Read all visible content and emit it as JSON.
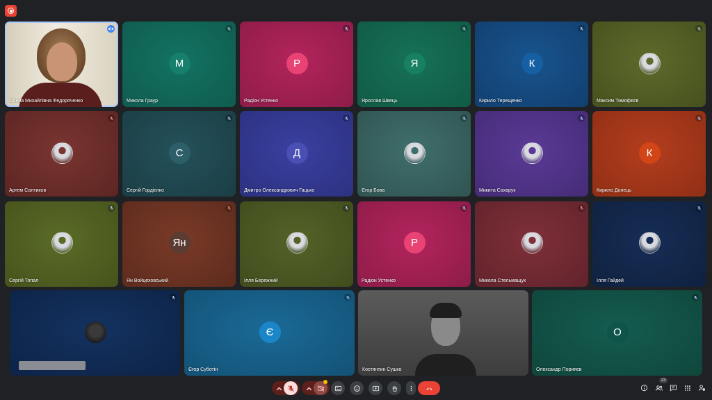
{
  "recording_icon": "record-icon",
  "participants": [
    {
      "name": "Олена Михайлівна Федоряченко",
      "initial": "",
      "kind": "video-woman",
      "bg": "#7a7d80",
      "bg2": "#c9c1b0",
      "status": "speaking"
    },
    {
      "name": "Микола Граур",
      "initial": "М",
      "kind": "letter",
      "bg": "#137261",
      "bg2": "#0f5c50",
      "avatar": "#16806d",
      "status": "muted"
    },
    {
      "name": "Радіон Устенко",
      "initial": "Р",
      "kind": "letter",
      "bg": "#b3245c",
      "bg2": "#8d1c49",
      "avatar": "#e94374",
      "status": "muted"
    },
    {
      "name": "Ярослав Швець",
      "initial": "Я",
      "kind": "letter",
      "bg": "#167256",
      "bg2": "#115a45",
      "avatar": "#178062",
      "status": "muted"
    },
    {
      "name": "Кирило Терещенко",
      "initial": "К",
      "kind": "letter",
      "bg": "#18548e",
      "bg2": "#123f6f",
      "avatar": "#165fa3",
      "status": "muted"
    },
    {
      "name": "Максим Тимофєєв",
      "initial": "",
      "kind": "photo",
      "bg": "#5d6a2b",
      "bg2": "#46511e",
      "status": "muted"
    },
    {
      "name": "Артем Салтиков",
      "initial": "",
      "kind": "photo",
      "bg": "#7a3531",
      "bg2": "#5c2522",
      "status": "muted-red"
    },
    {
      "name": "Сергій Гордієнко",
      "initial": "С",
      "kind": "letter",
      "bg": "#24515a",
      "bg2": "#1b3e45",
      "avatar": "#2d5f69",
      "status": "muted"
    },
    {
      "name": "Дмитро Олександрович Гацько",
      "initial": "Д",
      "kind": "letter",
      "bg": "#3a40a0",
      "bg2": "#2c3180",
      "avatar": "#4a50b3",
      "status": "muted"
    },
    {
      "name": "Єгор Бова",
      "initial": "",
      "kind": "photo",
      "bg": "#3f6f6c",
      "bg2": "#305452",
      "status": "muted"
    },
    {
      "name": "Микита Сахарук",
      "initial": "",
      "kind": "photo",
      "bg": "#5a3a96",
      "bg2": "#452b77",
      "status": "muted"
    },
    {
      "name": "Кирило Донець",
      "initial": "К",
      "kind": "letter",
      "bg": "#b43d1e",
      "bg2": "#902f15",
      "avatar": "#d24517",
      "status": "muted"
    },
    {
      "name": "Сергій Топал",
      "initial": "",
      "kind": "photo",
      "bg": "#5a6b26",
      "bg2": "#46531c",
      "status": "muted"
    },
    {
      "name": "Ян Войцеховський",
      "initial": "Ян",
      "kind": "letter",
      "bg": "#7a3a28",
      "bg2": "#5d2b1d",
      "avatar": "#5b3c32",
      "status": "muted-red"
    },
    {
      "name": "Ілля Бережний",
      "initial": "",
      "kind": "photo",
      "bg": "#546228",
      "bg2": "#414c1d",
      "status": "muted"
    },
    {
      "name": "Радіон Устенко",
      "initial": "Р",
      "kind": "letter",
      "bg": "#b3245c",
      "bg2": "#8d1c49",
      "avatar": "#e94374",
      "status": "muted"
    },
    {
      "name": "Микола Стельмащук",
      "initial": "",
      "kind": "photo",
      "bg": "#7f3039",
      "bg2": "#62232b",
      "status": "muted-red"
    },
    {
      "name": "Ілля Гайдей",
      "initial": "",
      "kind": "photo",
      "bg": "#162d55",
      "bg2": "#0f2140",
      "status": "muted"
    },
    {
      "name": "",
      "initial": "",
      "kind": "photo-dark",
      "bg": "#143260",
      "bg2": "#0d2346",
      "status": "muted",
      "redacted": true
    },
    {
      "name": "Єгор Суботін",
      "initial": "Є",
      "kind": "letter",
      "bg": "#1a6a96",
      "bg2": "#135276",
      "avatar": "#1a86c8",
      "status": "muted"
    },
    {
      "name": "Костянтин Сушко",
      "initial": "",
      "kind": "video-man",
      "bg": "#4a4a4a",
      "bg2": "#2e2e2e",
      "status": "none"
    },
    {
      "name": "Олександр Порияєв",
      "initial": "О",
      "kind": "letter",
      "bg": "#155c4f",
      "bg2": "#0f463c",
      "avatar": "#0e5448",
      "status": "muted"
    }
  ],
  "controls": {
    "mic": "mic-off-icon",
    "camera": "camera-off-icon",
    "captions": "captions-icon",
    "emoji": "emoji-icon",
    "present": "present-icon",
    "hand": "raise-hand-icon",
    "more": "more-options-icon",
    "leave": "hang-up-icon"
  },
  "right_panel": {
    "info": "info-icon",
    "people": "people-icon",
    "people_count": "23",
    "chat": "chat-icon",
    "activities": "activities-icon",
    "host": "host-controls-icon"
  }
}
